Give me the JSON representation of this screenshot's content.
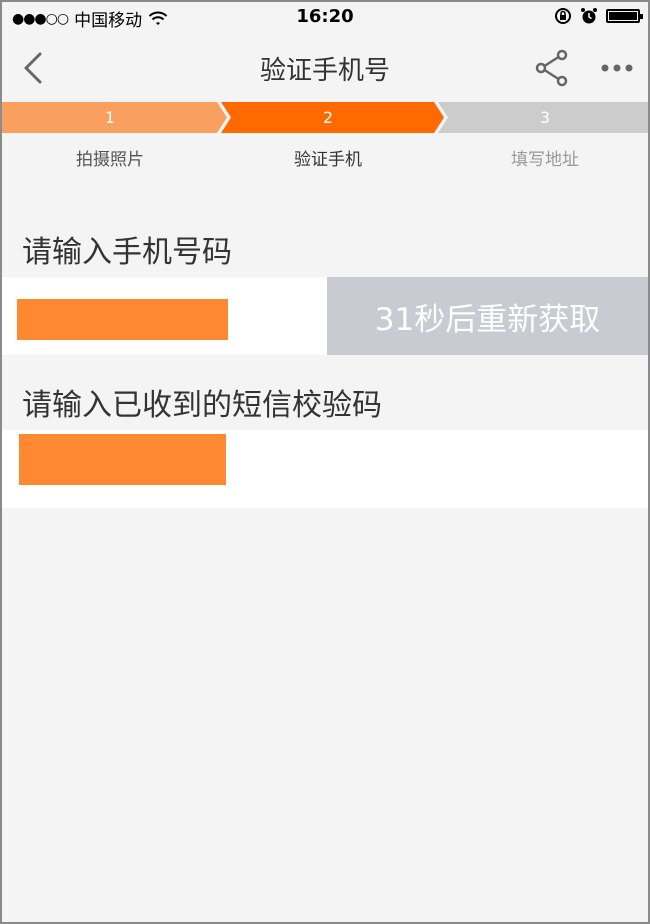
{
  "status_bar": {
    "signal_dots": "●●●○○",
    "carrier": "中国移动",
    "time": "16:20"
  },
  "nav": {
    "title": "验证手机号"
  },
  "steps": [
    {
      "number": "1",
      "label": "拍摄照片"
    },
    {
      "number": "2",
      "label": "验证手机"
    },
    {
      "number": "3",
      "label": "填写地址"
    }
  ],
  "phone_section": {
    "title": "请输入手机号码",
    "resend_button": "31秒后重新获取"
  },
  "sms_section": {
    "title": "请输入已收到的短信校验码"
  },
  "colors": {
    "step_done": "#f9a061",
    "step_active": "#ff6a00",
    "step_pending": "#cccccc",
    "button_disabled": "#c8cbd2"
  }
}
